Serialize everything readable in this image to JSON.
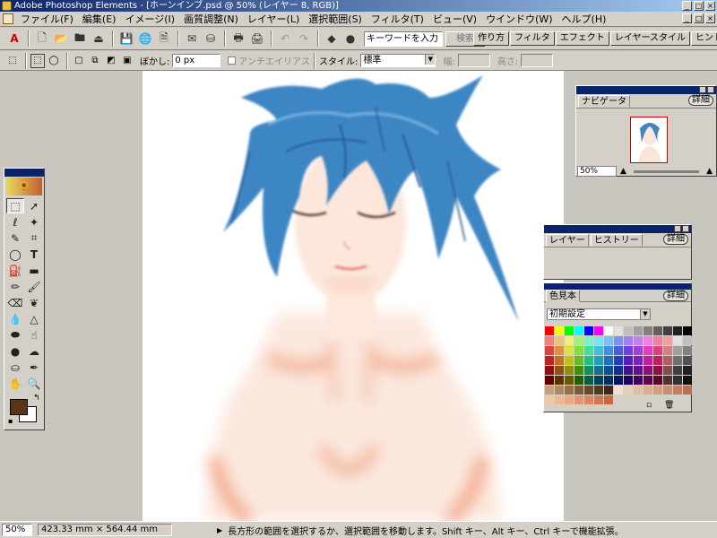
{
  "window": {
    "title": "Adobe Photoshop Elements - [ホーンインブ.psd @ 50% (レイヤー 8, RGB)]",
    "minimize": "_",
    "maximize": "□",
    "close": "×"
  },
  "menu": [
    "ファイル(F)",
    "編集(E)",
    "イメージ(I)",
    "画質調整(N)",
    "レイヤー(L)",
    "選択範囲(S)",
    "フィルタ(T)",
    "ビュー(V)",
    "ウインドウ(W)",
    "ヘルプ(H)"
  ],
  "toolbar": {
    "search_placeholder": "キーワードを入力",
    "search_button": "検索",
    "help": "?"
  },
  "palette_well": [
    "作り方",
    "フィルタ",
    "エフェクト",
    "レイヤースタイル",
    "ヒント"
  ],
  "options": {
    "feather_label": "ぼかし:",
    "feather_value": "0 px",
    "antialias": "アンチエイリアス",
    "style_label": "スタイル:",
    "style_value": "標準",
    "width_label": "幅:",
    "height_label": "高さ:"
  },
  "navigator": {
    "title": "ナビゲータ",
    "detail": "詳細",
    "zoom": "50%"
  },
  "layers": {
    "tab1": "レイヤー",
    "tab2": "ヒストリー",
    "detail": "詳細"
  },
  "swatches": {
    "title": "色見本",
    "detail": "詳細",
    "set": "初期設定",
    "colors": [
      "#ff0000",
      "#ffff00",
      "#00ff00",
      "#00ffff",
      "#0000ff",
      "#ff00ff",
      "#ffffff",
      "#e0e0e0",
      "#c0c0c0",
      "#a0a0a0",
      "#808080",
      "#606060",
      "#404040",
      "#202020",
      "#000000",
      "#f08080",
      "#f0c080",
      "#f0f080",
      "#a0f080",
      "#80f0c0",
      "#80e0f0",
      "#80c0f0",
      "#8090f0",
      "#a080f0",
      "#c080f0",
      "#f080e0",
      "#f080a0",
      "#f0a0a0",
      "#e0e0e0",
      "#c0c0c0",
      "#e04040",
      "#e09040",
      "#e0e040",
      "#80e040",
      "#40e0a0",
      "#40c0e0",
      "#4090e0",
      "#4060e0",
      "#7040e0",
      "#a040e0",
      "#e040c0",
      "#e04080",
      "#d08080",
      "#a0a0a0",
      "#808080",
      "#c02020",
      "#c07020",
      "#c0c020",
      "#60c020",
      "#20c080",
      "#20a0c0",
      "#2070c0",
      "#2040c0",
      "#5020c0",
      "#8020c0",
      "#c020a0",
      "#c02060",
      "#b06060",
      "#707070",
      "#505050",
      "#901010",
      "#905010",
      "#909010",
      "#409010",
      "#109060",
      "#107090",
      "#105090",
      "#103090",
      "#401090",
      "#601090",
      "#901070",
      "#901040",
      "#805050",
      "#404040",
      "#202020",
      "#600000",
      "#603000",
      "#606000",
      "#206000",
      "#006040",
      "#004060",
      "#003060",
      "#001860",
      "#200060",
      "#400060",
      "#600050",
      "#600030",
      "#503030",
      "#303030",
      "#101010",
      "#c8a078",
      "#b08860",
      "#987048",
      "#805838",
      "#684828",
      "#503820",
      "#402818",
      "#f0e0d0",
      "#e8d0b8",
      "#e0c0a0",
      "#d8b090",
      "#d0a080",
      "#c89070",
      "#c08060",
      "#b87050",
      "#f0c8a0",
      "#f0b890",
      "#e8a880",
      "#e09870",
      "#d88860",
      "#d07850",
      "#c86840"
    ]
  },
  "status": {
    "zoom": "50%",
    "doc_size": "423.33 mm × 564.44 mm",
    "arrow": "▶",
    "message": "長方形の範囲を選択するか、選択範囲を移動します。Shift キー、Alt キー、Ctrl キーで機能拡張。"
  },
  "colors": {
    "foreground": "#5a3418",
    "background": "#ffffff",
    "title_bar": "#0a246a"
  }
}
